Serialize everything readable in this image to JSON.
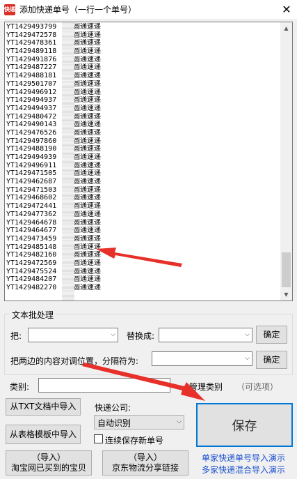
{
  "window": {
    "title": "添加快递单号（一行一个单号）",
    "close_glyph": "✕",
    "icon_label": "快递"
  },
  "textarea": {
    "lines": [
      {
        "prefix": "YT1429493799",
        "tail": "圆通速递"
      },
      {
        "prefix": "YT1429472578",
        "tail": "圆通速递"
      },
      {
        "prefix": "YT1429478361",
        "tail": "圆通速递"
      },
      {
        "prefix": "YT1429489118",
        "tail": "圆通速递"
      },
      {
        "prefix": "YT1429491876",
        "tail": "圆通速递"
      },
      {
        "prefix": "YT1429487227",
        "tail": "圆通速递"
      },
      {
        "prefix": "YT1429488181",
        "tail": "圆通速递"
      },
      {
        "prefix": "YT1429501707",
        "tail": "圆通速递"
      },
      {
        "prefix": "YT1429496912",
        "tail": "圆通速递"
      },
      {
        "prefix": "YT1429494937",
        "tail": "圆通速递"
      },
      {
        "prefix": "YT1429494937",
        "tail": "圆通速递"
      },
      {
        "prefix": "YT1429480472",
        "tail": "圆通速递"
      },
      {
        "prefix": "YT1429490143",
        "tail": "圆通速递"
      },
      {
        "prefix": "YT1429476526",
        "tail": "圆通速递"
      },
      {
        "prefix": "YT1429497860",
        "tail": "圆通速递"
      },
      {
        "prefix": "YT1429488190",
        "tail": "圆通速递"
      },
      {
        "prefix": "YT1429494939",
        "tail": "圆通速递"
      },
      {
        "prefix": "YT1429496911",
        "tail": "圆通速递"
      },
      {
        "prefix": "YT1429471505",
        "tail": "圆通速递"
      },
      {
        "prefix": "YT1429462687",
        "tail": "圆通速递"
      },
      {
        "prefix": "YT1429471503",
        "tail": "圆通速递"
      },
      {
        "prefix": "YT1429468602",
        "tail": "圆通速递"
      },
      {
        "prefix": "YT1429472441",
        "tail": "圆通速递"
      },
      {
        "prefix": "YT1429477362",
        "tail": "圆通速递"
      },
      {
        "prefix": "YT1429464678",
        "tail": "圆通速递"
      },
      {
        "prefix": "YT1429464677",
        "tail": "圆通速递"
      },
      {
        "prefix": "YT1429473459",
        "tail": "圆通速递"
      },
      {
        "prefix": "YT1429485148",
        "tail": "圆通速递"
      },
      {
        "prefix": "YT1429482160",
        "tail": "圆通速递"
      },
      {
        "prefix": "YT1429472569",
        "tail": "圆通速递"
      },
      {
        "prefix": "YT1429475524",
        "tail": "圆通速递"
      },
      {
        "prefix": "YT1429484207",
        "tail": "圆通速递"
      },
      {
        "prefix": "YT1429482270",
        "tail": "圆通速递"
      }
    ]
  },
  "text_processing": {
    "legend": "文本批处理",
    "from_label": "把:",
    "replace_label": "替换成:",
    "confirm_label": "确定",
    "swap_label": "把两边的内容对调位置，分隔符为:",
    "confirm2_label": "确定"
  },
  "category": {
    "label": "类别:",
    "manage_label": "+管理类别",
    "optional_label": "（可选项）"
  },
  "courier": {
    "label": "快递公司:",
    "selected": "自动识别",
    "keep_saving_label": "连续保存新单号"
  },
  "buttons": {
    "import_txt": "从TXT文档中导入",
    "import_table": "从表格模板中导入",
    "import_taobao_top": "（导入）",
    "import_taobao_bottom": "淘宝网已买到的宝贝",
    "import_jd_top": "（导入）",
    "import_jd_bottom": "京东物流分享链接",
    "save": "保存"
  },
  "links": {
    "single_demo": "单家快递单号导入演示",
    "multi_demo": "多家快递混合导入演示"
  },
  "colors": {
    "arrow_red": "#e8302a",
    "link_blue": "#1a4fd0",
    "save_border": "#0078d7"
  }
}
